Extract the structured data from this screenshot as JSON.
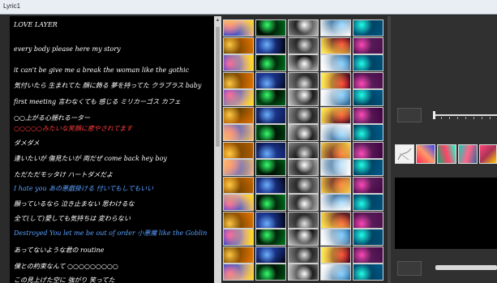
{
  "window": {
    "title": "Lyric1"
  },
  "lyrics": [
    {
      "text": "LOVE LAYER",
      "color": "#ffffff"
    },
    {
      "text": "every body please here my story",
      "color": "#ffffff"
    },
    {
      "text": "it can't be give me a break the woman like the gothic",
      "color": "#ffffff"
    },
    {
      "text": "気付いたら 生まれてた 顔に飾る 夢を持ってた クラブラス baby",
      "color": "#ffffff"
    },
    {
      "text": "first meeting 言わなくても 感じる ミリカーゴス カフェ",
      "color": "#ffffff"
    },
    {
      "text": "○○上がる心揺れるーター",
      "color": "#ffffff"
    },
    {
      "text": "○○○○○みたいな笑顔に癒やされてます",
      "color": "#ff3b3b"
    },
    {
      "text": "ダメダメ",
      "color": "#ffffff"
    },
    {
      "text": "逢いたいが 傷見たいが 両だぜ come back hey boy",
      "color": "#ffffff"
    },
    {
      "text": "ただただモッタけ ハートダメだよ",
      "color": "#ffffff"
    },
    {
      "text": "I hate you あの悪戯掛ける 付いてもしてもいい",
      "color": "#5aa0ff"
    },
    {
      "text": "願っているなら 泣き止まない 思わけるな",
      "color": "#ffffff"
    },
    {
      "text": "全て(して)愛しても気持ちは 変わらない",
      "color": "#ffffff"
    },
    {
      "text": "Destroyed You let me be out of order 小悪魔 like the Goblin",
      "color": "#5aa0ff"
    },
    {
      "text": "あってないような君の routine",
      "color": "#ffffff"
    },
    {
      "text": "僕との約束なんて ○○○○○○○○○",
      "color": "#ffffff"
    },
    {
      "text": "この見上げた空に 強がり 笑ってた",
      "color": "#ffffff"
    }
  ],
  "thumbnails": [
    {
      "name": "red-stripes",
      "colors": [
        "#ff2a55",
        "#ff9966",
        "#3344ff"
      ]
    },
    {
      "name": "green-wave",
      "colors": [
        "#11aa77",
        "#ff4466",
        "#22ffcc"
      ]
    },
    {
      "name": "teal-swirl",
      "colors": [
        "#11ccbb",
        "#ff6688",
        "#336699"
      ]
    },
    {
      "name": "pink-burst",
      "colors": [
        "#ff4477",
        "#aa3355",
        "#ffcc00"
      ]
    }
  ]
}
